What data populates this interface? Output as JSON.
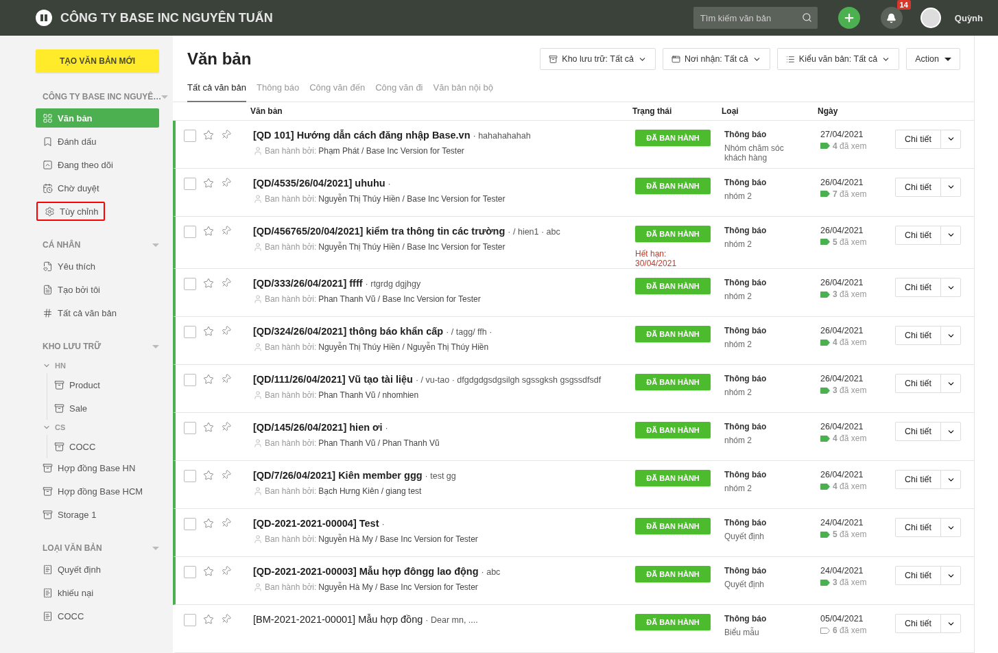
{
  "header": {
    "title": "CÔNG TY BASE INC NGUYÊN TUẤN",
    "search": {
      "placeholder": "Tìm kiếm văn bản"
    },
    "notifications": "14",
    "user": "Quỳnh"
  },
  "sidebar": {
    "create_button": "TẠO VĂN BẢN MỚI",
    "sections": [
      {
        "title": "CÔNG TY BASE INC NGUYÊ…",
        "items": [
          {
            "label": "Văn bản",
            "kind": "grid",
            "selected": true,
            "highlighted": false
          },
          {
            "label": "Đánh dấu",
            "kind": "bookmark",
            "selected": false,
            "highlighted": false
          },
          {
            "label": "Đang theo dõi",
            "kind": "follow",
            "selected": false,
            "highlighted": false
          },
          {
            "label": "Chờ duyệt",
            "kind": "pending",
            "selected": false,
            "highlighted": false
          },
          {
            "label": "Tùy chỉnh",
            "kind": "gear",
            "selected": false,
            "highlighted": true
          }
        ]
      },
      {
        "title": "CÁ NHÂN",
        "items": [
          {
            "label": "Yêu thích",
            "kind": "favorite",
            "selected": false,
            "highlighted": false
          },
          {
            "label": "Tạo bởi tôi",
            "kind": "lines",
            "selected": false,
            "highlighted": false
          },
          {
            "label": "Tất cả văn bản",
            "kind": "hash",
            "selected": false,
            "highlighted": false
          }
        ]
      },
      {
        "title": "KHO LƯU TRỮ",
        "items": [
          {
            "label": "HN",
            "kind": "group",
            "expanded": true,
            "children": [
              {
                "label": "Product",
                "kind": "archive"
              },
              {
                "label": "Sale",
                "kind": "archive"
              }
            ]
          },
          {
            "label": "CS",
            "kind": "group",
            "expanded": true,
            "children": [
              {
                "label": "COCC",
                "kind": "archive"
              }
            ]
          },
          {
            "label": "Hợp đồng Base HN",
            "kind": "archive",
            "selected": false,
            "highlighted": false
          },
          {
            "label": "Hợp đồng Base HCM",
            "kind": "archive",
            "selected": false,
            "highlighted": false
          },
          {
            "label": "Storage 1",
            "kind": "archive",
            "selected": false,
            "highlighted": false
          }
        ]
      },
      {
        "title": "LOẠI VĂN BẢN",
        "items": [
          {
            "label": "Quyết định",
            "kind": "doctype",
            "selected": false,
            "highlighted": false
          },
          {
            "label": "khiếu nại",
            "kind": "doctype",
            "selected": false,
            "highlighted": false
          },
          {
            "label": "COCC",
            "kind": "doctype",
            "selected": false,
            "highlighted": false
          }
        ]
      }
    ]
  },
  "page": {
    "title": "Văn bản",
    "filters": [
      {
        "label": "Kho lưu trữ: Tất cả",
        "kind": "archive"
      },
      {
        "label": "Nơi nhận: Tất cả",
        "kind": "window"
      },
      {
        "label": "Kiểu văn bản: Tất cả",
        "kind": "list"
      }
    ],
    "action": "Action",
    "tabs": [
      {
        "label": "Tất cả văn bản",
        "selected": true
      },
      {
        "label": "Thông báo",
        "selected": false
      },
      {
        "label": "Công văn đến",
        "selected": false
      },
      {
        "label": "Công văn đi",
        "selected": false
      },
      {
        "label": "Văn bản nội bộ",
        "selected": false
      }
    ]
  },
  "table": {
    "columns": [
      "Văn bản",
      "Trạng thái",
      "Loại",
      "Ngày"
    ],
    "rows": [
      {
        "title": "[QD 101] Hướng dẫn cách đăng nhập Base.vn",
        "extra": "· hahahahahah",
        "issuer_label": "Ban hành bởi:",
        "issuer": "Phạm Phát / Base Inc Version for Tester",
        "status": "ĐÃ BAN HÀNH",
        "expiry": null,
        "type": "Thông báo",
        "group": "Nhóm chăm sóc khách hàng",
        "date": "27/04/2021",
        "views": "4",
        "views_label": "đã xem",
        "unread": true,
        "seen_by_all": true,
        "checked": false,
        "detail": "Chi tiết"
      },
      {
        "title": "[QD/4535/26/04/2021] uhuhu",
        "extra": "·",
        "issuer_label": "Ban hành bởi:",
        "issuer": "Nguyễn Thị Thúy Hiền / Base Inc Version for Tester",
        "status": "ĐÃ BAN HÀNH",
        "expiry": null,
        "type": "Thông báo",
        "group": "nhóm 2",
        "date": "26/04/2021",
        "views": "7",
        "views_label": "đã xem",
        "unread": true,
        "seen_by_all": true,
        "checked": false,
        "detail": "Chi tiết"
      },
      {
        "title": "[QD/456765/20/04/2021] kiểm tra thông tin các trường",
        "extra": "· / hien1 · abc",
        "issuer_label": "Ban hành bởi:",
        "issuer": "Nguyễn Thị Thúy Hiền / Base Inc Version for Tester",
        "status": "ĐÃ BAN HÀNH",
        "expiry": "Hết hạn: 30/04/2021",
        "type": "Thông báo",
        "group": "nhóm 2",
        "date": "26/04/2021",
        "views": "5",
        "views_label": "đã xem",
        "unread": true,
        "seen_by_all": true,
        "checked": false,
        "detail": "Chi tiết"
      },
      {
        "title": "[QD/333/26/04/2021] ffff",
        "extra": "· rtgrdg dgjhgy",
        "issuer_label": "Ban hành bởi:",
        "issuer": "Phan Thanh Vũ / Base Inc Version for Tester",
        "status": "ĐÃ BAN HÀNH",
        "expiry": null,
        "type": "Thông báo",
        "group": "nhóm 2",
        "date": "26/04/2021",
        "views": "3",
        "views_label": "đã xem",
        "unread": true,
        "seen_by_all": true,
        "checked": false,
        "detail": "Chi tiết"
      },
      {
        "title": "[QD/324/26/04/2021] thông báo khẩn cấp",
        "extra": "· / tagg/ ffh ·",
        "issuer_label": "Ban hành bởi:",
        "issuer": "Nguyễn Thị Thúy Hiền / Nguyễn Thị Thúy Hiền",
        "status": "ĐÃ BAN HÀNH",
        "expiry": null,
        "type": "Thông báo",
        "group": "nhóm 2",
        "date": "26/04/2021",
        "views": "4",
        "views_label": "đã xem",
        "unread": true,
        "seen_by_all": true,
        "checked": false,
        "detail": "Chi tiết"
      },
      {
        "title": "[QD/111/26/04/2021] Vũ tạo tài liệu",
        "extra": "· / vu-tao · dfgdgdgsdgsilgh sgssgksh gsgssdfsdf",
        "issuer_label": "Ban hành bởi:",
        "issuer": "Phan Thanh Vũ / nhomhien",
        "status": "ĐÃ BAN HÀNH",
        "expiry": null,
        "type": "Thông báo",
        "group": "nhóm 2",
        "date": "26/04/2021",
        "views": "3",
        "views_label": "đã xem",
        "unread": true,
        "seen_by_all": true,
        "checked": false,
        "detail": "Chi tiết"
      },
      {
        "title": "[QD/145/26/04/2021] hien ơi",
        "extra": "·",
        "issuer_label": "Ban hành bởi:",
        "issuer": "Phan Thanh Vũ / Phan Thanh Vũ",
        "status": "ĐÃ BAN HÀNH",
        "expiry": null,
        "type": "Thông báo",
        "group": "nhóm 2",
        "date": "26/04/2021",
        "views": "4",
        "views_label": "đã xem",
        "unread": true,
        "seen_by_all": true,
        "checked": false,
        "detail": "Chi tiết"
      },
      {
        "title": "[QD/7/26/04/2021] Kiên member ggg",
        "extra": "· test gg",
        "issuer_label": "Ban hành bởi:",
        "issuer": "Bạch Hưng Kiên / giang test",
        "status": "ĐÃ BAN HÀNH",
        "expiry": null,
        "type": "Thông báo",
        "group": "nhóm 2",
        "date": "26/04/2021",
        "views": "4",
        "views_label": "đã xem",
        "unread": true,
        "seen_by_all": true,
        "checked": false,
        "detail": "Chi tiết"
      },
      {
        "title": "[QD-2021-2021-00004] Test",
        "extra": "·",
        "issuer_label": "Ban hành bởi:",
        "issuer": "Nguyễn Hà My / Base Inc Version for Tester",
        "status": "ĐÃ BAN HÀNH",
        "expiry": null,
        "type": "Thông báo",
        "group": "Quyết định",
        "date": "24/04/2021",
        "views": "5",
        "views_label": "đã xem",
        "unread": true,
        "seen_by_all": true,
        "checked": false,
        "detail": "Chi tiết"
      },
      {
        "title": "[QD-2021-2021-00003] Mẫu hợp đôngg lao động",
        "extra": "· abc",
        "issuer_label": "Ban hành bởi:",
        "issuer": "Nguyễn Hà My / Base Inc Version for Tester",
        "status": "ĐÃ BAN HÀNH",
        "expiry": null,
        "type": "Thông báo",
        "group": "Quyết định",
        "date": "24/04/2021",
        "views": "3",
        "views_label": "đã xem",
        "unread": true,
        "seen_by_all": true,
        "checked": false,
        "detail": "Chi tiết"
      },
      {
        "title": "[BM-2021-2021-00001] Mẫu hợp đồng",
        "extra": "· Dear mn, ....",
        "issuer_label": null,
        "issuer": null,
        "status": "ĐÃ BAN HÀNH",
        "expiry": null,
        "type": "Thông báo",
        "group": "Biểu mẫu",
        "date": "05/04/2021",
        "views": "6",
        "views_label": "đã xem",
        "unread": false,
        "seen_by_all": false,
        "checked": false,
        "detail": "Chi tiết"
      }
    ]
  }
}
